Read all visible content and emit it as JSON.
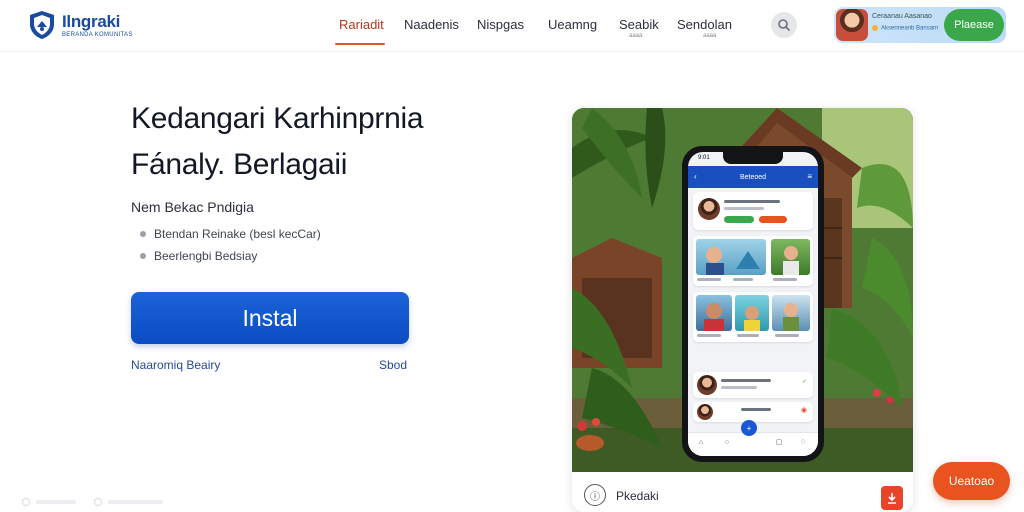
{
  "brand": {
    "name": "Ilngraki",
    "tagline": "BERANDA KOMUNITAS"
  },
  "nav": {
    "items": [
      {
        "label": "Rariadit",
        "active": true
      },
      {
        "label": "Naadenis",
        "active": false
      },
      {
        "label": "Nispgas",
        "active": false
      },
      {
        "label": "Ueamng",
        "active": false
      },
      {
        "label": "Seabik",
        "active": false,
        "sub": "aaaa"
      },
      {
        "label": "Sendolan",
        "active": false,
        "sub": "aaaa"
      }
    ],
    "search_icon": "search-icon"
  },
  "promo": {
    "line1": "Ceraanau Aasanao",
    "line2": "Aksenneanb Bansarn",
    "button_label": "Plaease"
  },
  "hero": {
    "title_line1": "Kedangari Karhinprnia",
    "title_line2": "Fánaly. Berlagaii",
    "subhead": "Nem Bekac Pndigia",
    "bullets": [
      "Btendan Reinake (besl kecCar)",
      "Beerlengbi Bedsiay"
    ],
    "install_label": "Instal",
    "link_left": "Naaromiq Beairy",
    "link_right": "Sbod"
  },
  "phone": {
    "status_time": "9:01",
    "appbar_title": "Beteoed",
    "bottom_nav_icons": [
      "home-icon",
      "search-icon",
      "plus-icon",
      "chat-icon",
      "bell-icon"
    ]
  },
  "card_footer": {
    "label": "Pkedaki"
  },
  "float_cta": {
    "label": "Ueatoao"
  },
  "colors": {
    "primary": "#0b4cc2",
    "accent_orange": "#e8531f",
    "accent_green": "#3aa84a",
    "nav_active": "#b23a1d"
  }
}
